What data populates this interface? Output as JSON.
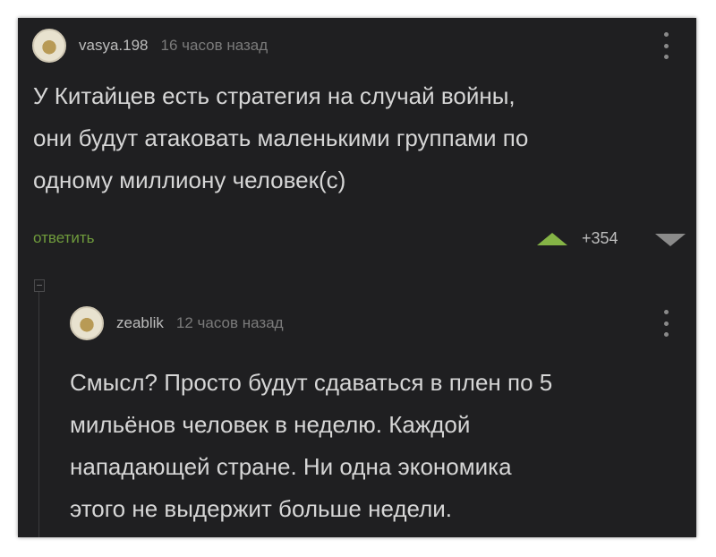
{
  "comment": {
    "username": "vasya.198",
    "time": "16 часов назад",
    "text_lines": [
      "У Китайцев есть стратегия на случай войны,",
      "они будут атаковать маленькими группами по",
      "одному миллиону человек(с)"
    ],
    "reply_label": "ответить",
    "rating": "+354"
  },
  "reply": {
    "username": "zeablik",
    "time": "12 часов назад",
    "text_lines": [
      "Смысл? Просто будут сдаваться в плен по 5",
      "мильёнов человек в неделю. Каждой",
      "нападающей стране. Ни одна экономика",
      "этого не выдержит больше недели."
    ]
  },
  "colors": {
    "background": "#1f1f21",
    "text": "#d6d6d6",
    "reply_link": "#6f9b3c",
    "upvote": "#85b446",
    "downvote": "#8a8a8a"
  }
}
